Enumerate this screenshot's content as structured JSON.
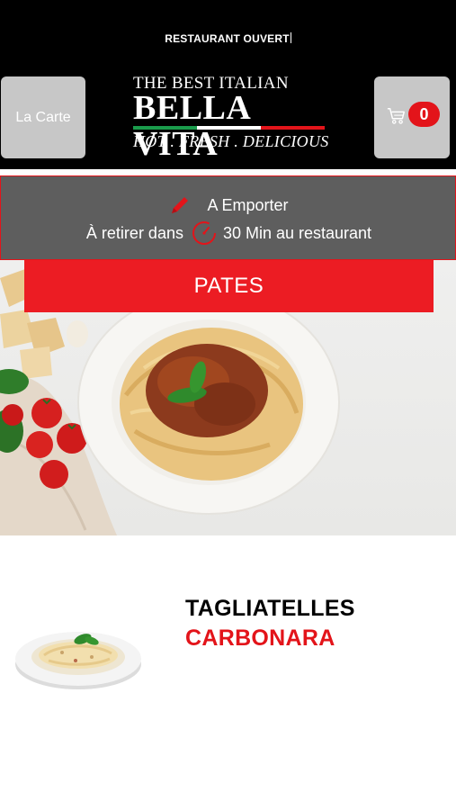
{
  "header": {
    "status": "RESTAURANT OUVERT",
    "menu_button_label": "La Carte",
    "cart_count": "0",
    "logo": {
      "line1": "THE BEST ITALIAN",
      "line2": "BELLA VITA",
      "line3": "HOT . FRESH . DELICIOUS"
    }
  },
  "order": {
    "mode": "A Emporter",
    "pickup_prefix": "À retirer dans",
    "pickup_time": "30 Min au restaurant"
  },
  "category": {
    "name": "PATES"
  },
  "items": [
    {
      "title": "TAGLIATELLES",
      "subtitle": "CARBONARA"
    }
  ],
  "colors": {
    "accent": "#e3141a",
    "header_bg": "#000000",
    "panel_bg": "#5e5e5e",
    "button_bg": "#c7c7c7"
  },
  "icons": {
    "cart": "cart-icon",
    "pencil": "pencil-icon",
    "timer": "timer-icon"
  }
}
